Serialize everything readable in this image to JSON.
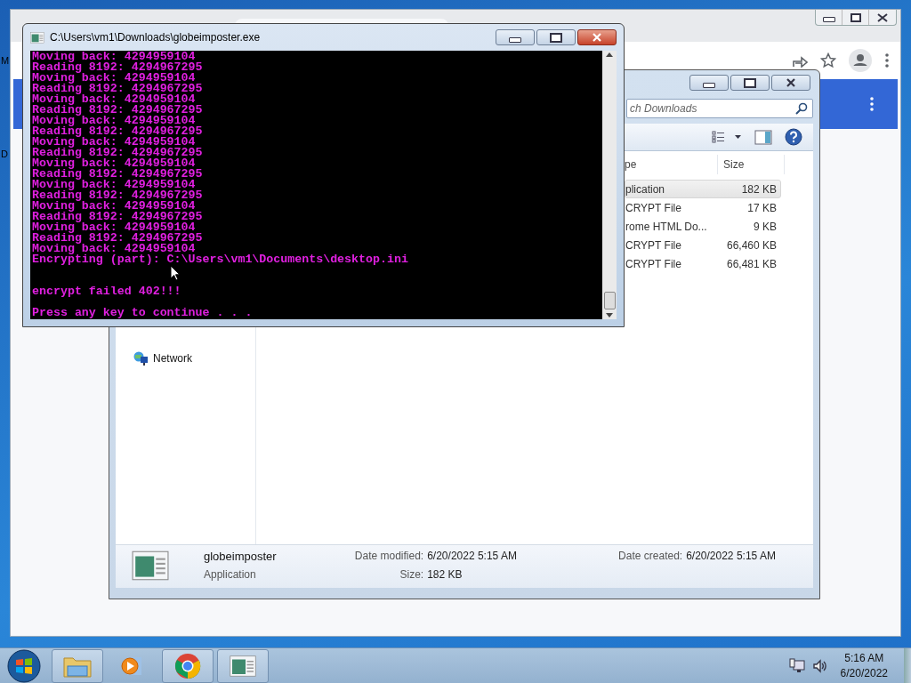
{
  "desktop": {
    "edge_labels": [
      "M",
      "D"
    ]
  },
  "console": {
    "title": "C:\\Users\\vm1\\Downloads\\globeimposter.exe",
    "output_lines": [
      "Moving back: 4294959104",
      "Reading 8192: 4294967295",
      "Moving back: 4294959104",
      "Reading 8192: 4294967295",
      "Moving back: 4294959104",
      "Reading 8192: 4294967295",
      "Moving back: 4294959104",
      "Reading 8192: 4294967295",
      "Moving back: 4294959104",
      "Reading 8192: 4294967295",
      "Moving back: 4294959104",
      "Reading 8192: 4294967295",
      "Moving back: 4294959104",
      "Reading 8192: 4294967295",
      "Moving back: 4294959104",
      "Reading 8192: 4294967295",
      "Moving back: 4294959104",
      "Reading 8192: 4294967295",
      "Moving back: 4294959104",
      "Encrypting (part): C:\\Users\\vm1\\Documents\\desktop.ini"
    ],
    "error_message": "encrypt failed 402!!!",
    "prompt": "Press any key to continue . . ."
  },
  "explorer": {
    "search": {
      "placeholder": "ch Downloads"
    },
    "columns": [
      "pe",
      "Size"
    ],
    "files": [
      {
        "type": "plication",
        "size": "182 KB",
        "selected": true
      },
      {
        "type": "CRYPT File",
        "size": "17 KB",
        "selected": false
      },
      {
        "type": "rome HTML Do...",
        "size": "9 KB",
        "selected": false
      },
      {
        "type": "CRYPT File",
        "size": "66,460 KB",
        "selected": false
      },
      {
        "type": "CRYPT File",
        "size": "66,481 KB",
        "selected": false
      }
    ],
    "nav_items": [
      {
        "label": "Network"
      }
    ],
    "details": {
      "name": "globeimposter",
      "type": "Application",
      "field_groups": [
        [
          {
            "label": "Date modified:",
            "value": "6/20/2022 5:15 AM"
          },
          {
            "label": "Size:",
            "value": "182 KB"
          }
        ],
        [
          {
            "label": "Date created:",
            "value": "6/20/2022 5:15 AM"
          }
        ]
      ]
    }
  },
  "taskbar": {
    "buttons": [
      {
        "kind": "explorer",
        "running": true
      },
      {
        "kind": "media",
        "running": false
      },
      {
        "kind": "chrome",
        "running": true
      },
      {
        "kind": "console",
        "running": true
      }
    ],
    "time": "5:16 AM",
    "date": "6/20/2022"
  }
}
